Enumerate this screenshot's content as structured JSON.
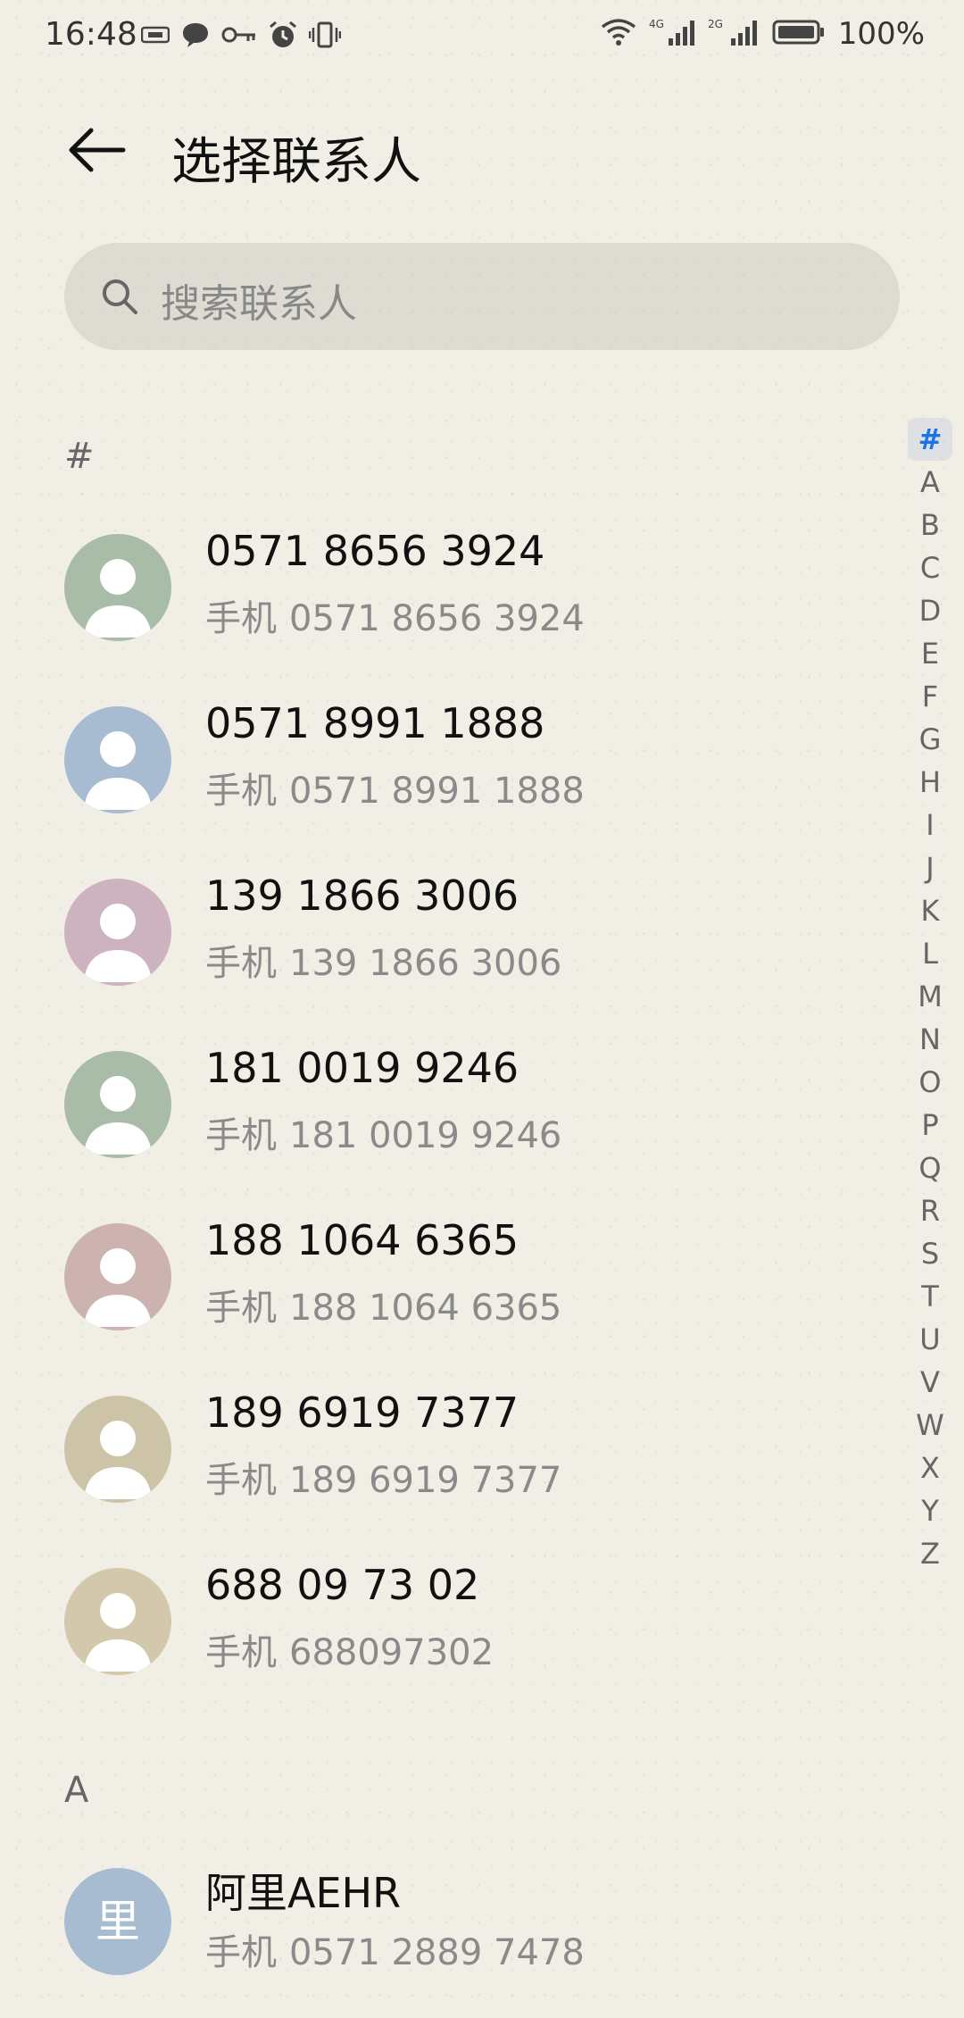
{
  "status_bar": {
    "time": "16:48",
    "left_icons": [
      "sim-card-icon",
      "message-bubble-icon",
      "key-icon",
      "alarm-icon",
      "vibrate-icon"
    ],
    "right_icons": [
      "wifi-icon",
      "signal-4g-icon",
      "signal-2g-icon",
      "battery-icon"
    ],
    "signal_a_label": "4G",
    "signal_b_label": "2G",
    "battery": "100%"
  },
  "header": {
    "title": "选择联系人",
    "back_icon": "back-arrow-icon"
  },
  "search": {
    "placeholder": "搜索联系人",
    "icon": "search-icon"
  },
  "sections": [
    {
      "label": "#",
      "contacts": [
        {
          "name": "0571 8656 3924",
          "label": "手机",
          "number": "0571 8656 3924",
          "avatar_color": "#a9bca7"
        },
        {
          "name": "0571 8991 1888",
          "label": "手机",
          "number": "0571 8991 1888",
          "avatar_color": "#a8bcd1"
        },
        {
          "name": "139 1866 3006",
          "label": "手机",
          "number": "139 1866 3006",
          "avatar_color": "#cdb3c0"
        },
        {
          "name": "181 0019 9246",
          "label": "手机",
          "number": "181 0019 9246",
          "avatar_color": "#a9bca7"
        },
        {
          "name": "188 1064 6365",
          "label": "手机",
          "number": "188 1064 6365",
          "avatar_color": "#cdb3b0"
        },
        {
          "name": "189 6919 7377",
          "label": "手机",
          "number": "189 6919 7377",
          "avatar_color": "#cdc4a8"
        },
        {
          "name": "688 09 73 02",
          "label": "手机",
          "number": "688097302",
          "avatar_color": "#d3c8ac"
        }
      ]
    },
    {
      "label": "A",
      "contacts": [
        {
          "name": "阿里AEHR",
          "label": "手机",
          "number": "0571 2889 7478",
          "avatar_color": "#a8bcd1",
          "avatar_letter": "里"
        }
      ]
    }
  ],
  "index_bar": {
    "letters": [
      "#",
      "A",
      "B",
      "C",
      "D",
      "E",
      "F",
      "G",
      "H",
      "I",
      "J",
      "K",
      "L",
      "M",
      "N",
      "O",
      "P",
      "Q",
      "R",
      "S",
      "T",
      "U",
      "V",
      "W",
      "X",
      "Y",
      "Z"
    ],
    "active": "#",
    "active_color": "#1a73e8"
  }
}
